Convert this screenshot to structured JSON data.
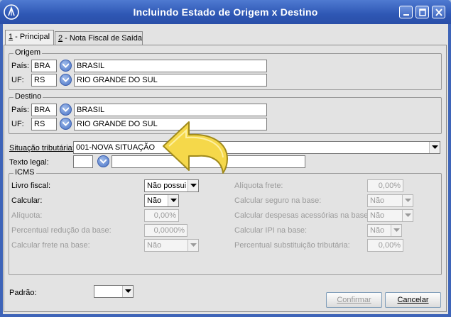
{
  "window": {
    "title": "Incluindo Estado de Origem x Destino"
  },
  "tabs": [
    {
      "key": "1",
      "label": " - Principal"
    },
    {
      "key": "2",
      "label": " - Nota Fiscal de Saída"
    }
  ],
  "origem": {
    "legend": "Origem",
    "pais_label": "País:",
    "pais_code": "BRA",
    "pais_name": "BRASIL",
    "uf_label": "UF:",
    "uf_code": "RS",
    "uf_name": "RIO GRANDE DO SUL"
  },
  "destino": {
    "legend": "Destino",
    "pais_label": "País:",
    "pais_code": "BRA",
    "pais_name": "BRASIL",
    "uf_label": "UF:",
    "uf_code": "RS",
    "uf_name": "RIO GRANDE DO SUL"
  },
  "situacao": {
    "label": "Situação tributária:",
    "value": "001-NOVA SITUAÇÃO"
  },
  "texto_legal": {
    "label": "Texto legal:",
    "code": "",
    "text": ""
  },
  "icms": {
    "legend": "ICMS",
    "livro_fiscal_label": "Livro fiscal:",
    "livro_fiscal_value": "Não possui",
    "calcular_label": "Calcular:",
    "calcular_value": "Não",
    "aliquota_label": "Alíquota:",
    "aliquota_value": "0,00%",
    "perc_reducao_label": "Percentual redução da base:",
    "perc_reducao_value": "0,0000%",
    "calc_frete_base_label": "Calcular frete na base:",
    "calc_frete_base_value": "Não",
    "aliquota_frete_label": "Alíquota frete:",
    "aliquota_frete_value": "0,00%",
    "calc_seguro_label": "Calcular seguro na base:",
    "calc_seguro_value": "Não",
    "calc_despesas_label": "Calcular despesas acessórias na base:",
    "calc_despesas_value": "Não",
    "calc_ipi_label": "Calcular IPI na base:",
    "calc_ipi_value": "Não",
    "perc_subst_label": "Percentual substituição tributária:",
    "perc_subst_value": "0,00%"
  },
  "padrao": {
    "label": "Padrão:",
    "value": ""
  },
  "buttons": {
    "confirmar": "Confirmar",
    "cancelar": "Cancelar"
  },
  "colors": {
    "titlebar": "#2e57b4",
    "client_bg": "#e3e3e3",
    "arrow_fill": "#f5d84a"
  }
}
